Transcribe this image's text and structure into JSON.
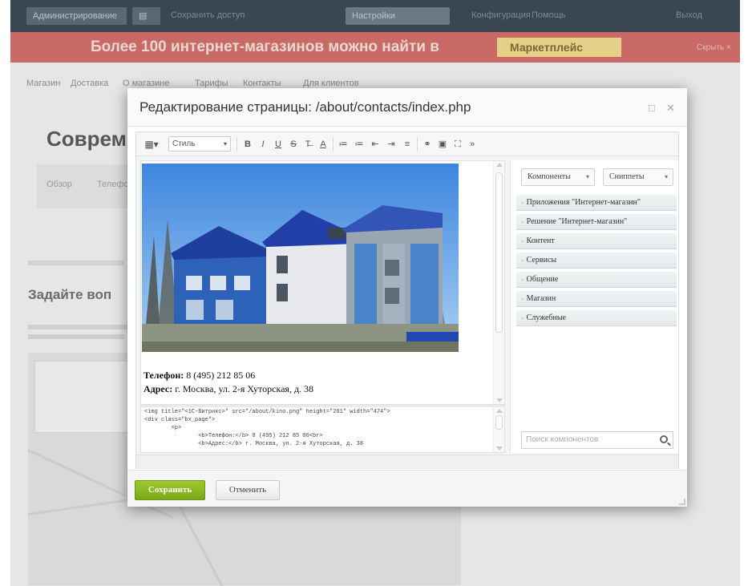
{
  "background_page": {
    "admin_bar": {
      "buttons": [
        "Администрирование",
        "▤",
        "Сохранить доступ",
        "Настройки",
        "Конфигурация",
        "Помощь",
        "Выход"
      ],
      "texts": []
    },
    "promo": {
      "text": "Более 100 интернет-магазинов можно найти в",
      "badge": "Маркетплейс",
      "close": "Скрыть ×"
    },
    "menu": [
      "Магазин",
      "Доставка",
      "О магазине",
      "Тарифы",
      "Контакты",
      "Для клиентов"
    ],
    "title": "Соврем",
    "tabs": [
      "Обзор",
      "Телефо"
    ],
    "heading": "Задайте воп"
  },
  "modal": {
    "title": "Редактирование страницы: /about/contacts/index.php",
    "toolbar": {
      "style_select": "Стиль",
      "buttons": [
        "B",
        "I",
        "U",
        "S",
        "T̶",
        "A",
        "≔",
        "≔",
        "⇤",
        "⇥",
        "≡",
        "⚭",
        "▣",
        "⛶",
        "»"
      ]
    },
    "editor": {
      "phone_label": "Телефон:",
      "phone_value": " 8 (495) 212 85 06",
      "address_label": "Адрес:",
      "address_value": " г. Москва, ул. 2-я Хуторская, д. 38"
    },
    "source_code": [
      "<img title=\"<1C-Битрикс>\" src=\"/about/kino.png\" height=\"261\" width=\"474\">",
      "<div class=\"bx_page\">",
      "        <p>",
      "                <b>Телефон:</b> 8 (495) 212 85 06<br>",
      "                <b>Адрес:</b> г. Москва, ул. 2-я Хуторская, д. 38"
    ],
    "sidepanel": {
      "components_btn": "Компоненты",
      "snippets_btn": "Сниппеты",
      "items": [
        "Приложения \"Интернет-магазин\"",
        "Решение \"Интернет-магазин\"",
        "Контент",
        "Сервисы",
        "Общение",
        "Магазин",
        "Служебные"
      ],
      "search_placeholder": "Поиск компонентов"
    },
    "footer": {
      "save": "Сохранить",
      "cancel": "Отменить"
    }
  }
}
